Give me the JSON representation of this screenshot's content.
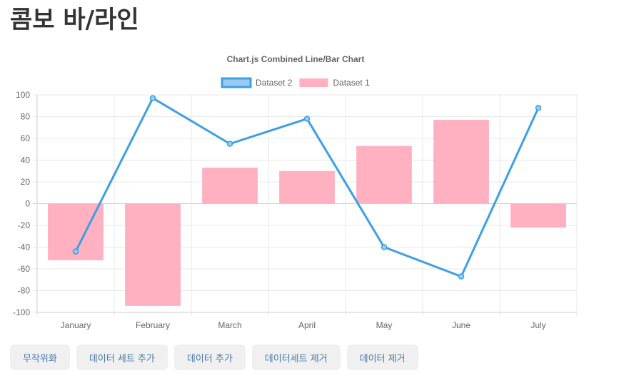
{
  "page": {
    "title": "콤보 바/라인"
  },
  "buttons": {
    "randomize": "무작위화",
    "add_dataset": "데이터 세트 추가",
    "add_data": "데이터 추가",
    "remove_dataset": "데이터세트 제거",
    "remove_data": "데이터 제거"
  },
  "chart_data": {
    "type": "bar",
    "title": "Chart.js Combined Line/Bar Chart",
    "categories": [
      "January",
      "February",
      "March",
      "April",
      "May",
      "June",
      "July"
    ],
    "ylim": [
      -100,
      100
    ],
    "yticks": [
      100,
      80,
      60,
      40,
      20,
      0,
      -20,
      -40,
      -60,
      -80,
      -100
    ],
    "grid": true,
    "legend_position": "top",
    "series": [
      {
        "name": "Dataset 2",
        "type": "line",
        "color": "#3da0e3",
        "fill_color": "#9ccbf2",
        "values": [
          -44,
          97,
          55,
          78,
          -40,
          -67,
          88
        ]
      },
      {
        "name": "Dataset 1",
        "type": "bar",
        "color": "#ffb0c1",
        "values": [
          -52,
          -94,
          33,
          30,
          53,
          77,
          -22
        ]
      }
    ]
  }
}
